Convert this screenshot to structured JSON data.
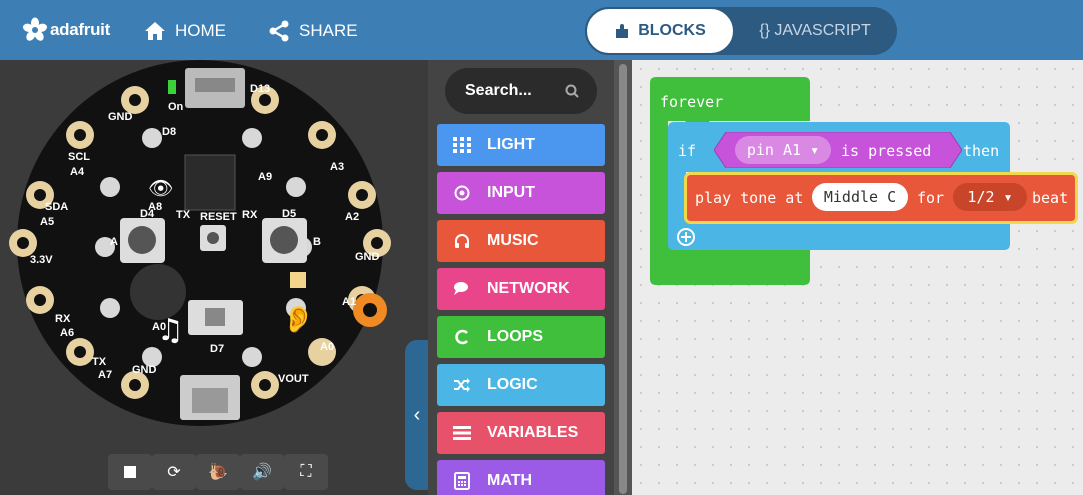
{
  "header": {
    "logo_text": "adafruit",
    "home_label": "HOME",
    "share_label": "SHARE",
    "tab_blocks": "BLOCKS",
    "tab_javascript": "{} JAVASCRIPT"
  },
  "toolbox": {
    "search_placeholder": "Search...",
    "categories": [
      {
        "label": "LIGHT",
        "color": "#4b97f0",
        "icon": "grid-icon"
      },
      {
        "label": "INPUT",
        "color": "#c653d9",
        "icon": "target-icon"
      },
      {
        "label": "MUSIC",
        "color": "#e8573a",
        "icon": "headphones-icon"
      },
      {
        "label": "NETWORK",
        "color": "#e8458a",
        "icon": "chat-icon"
      },
      {
        "label": "LOOPS",
        "color": "#3fbf3c",
        "icon": "loop-icon"
      },
      {
        "label": "LOGIC",
        "color": "#4bb6e6",
        "icon": "shuffle-icon"
      },
      {
        "label": "VARIABLES",
        "color": "#e8516a",
        "icon": "list-icon"
      },
      {
        "label": "MATH",
        "color": "#9b5be6",
        "icon": "calculator-icon"
      }
    ]
  },
  "board": {
    "labels": [
      "On",
      "D13",
      "GND",
      "D8",
      "SCL",
      "A4",
      "SDA",
      "A5",
      "3.3V",
      "RX",
      "A6",
      "TX",
      "A7",
      "A9",
      "A8",
      "A3",
      "A2",
      "GND",
      "A1",
      "A0",
      "VOUT",
      "GND",
      "D4",
      "D5",
      "D7",
      "RESET",
      "TX",
      "RX",
      "A",
      "B",
      "A0"
    ]
  },
  "simulator_controls": [
    "stop-icon",
    "restart-icon",
    "slow-mo-icon",
    "sound-icon",
    "fullscreen-icon"
  ],
  "workspace": {
    "forever_label": "forever",
    "if_label": "if",
    "pin_value": "pin A1 ▾",
    "is_pressed_label": "is pressed",
    "then_label": "then",
    "play_label": "play tone at",
    "note_value": "Middle C",
    "for_label": "for",
    "beat_value": "1/2 ▾",
    "beat_label": "beat",
    "colors": {
      "loops": "#3fbf3c",
      "logic": "#4bb6e6",
      "input": "#c653d9",
      "music": "#e8573a"
    }
  }
}
